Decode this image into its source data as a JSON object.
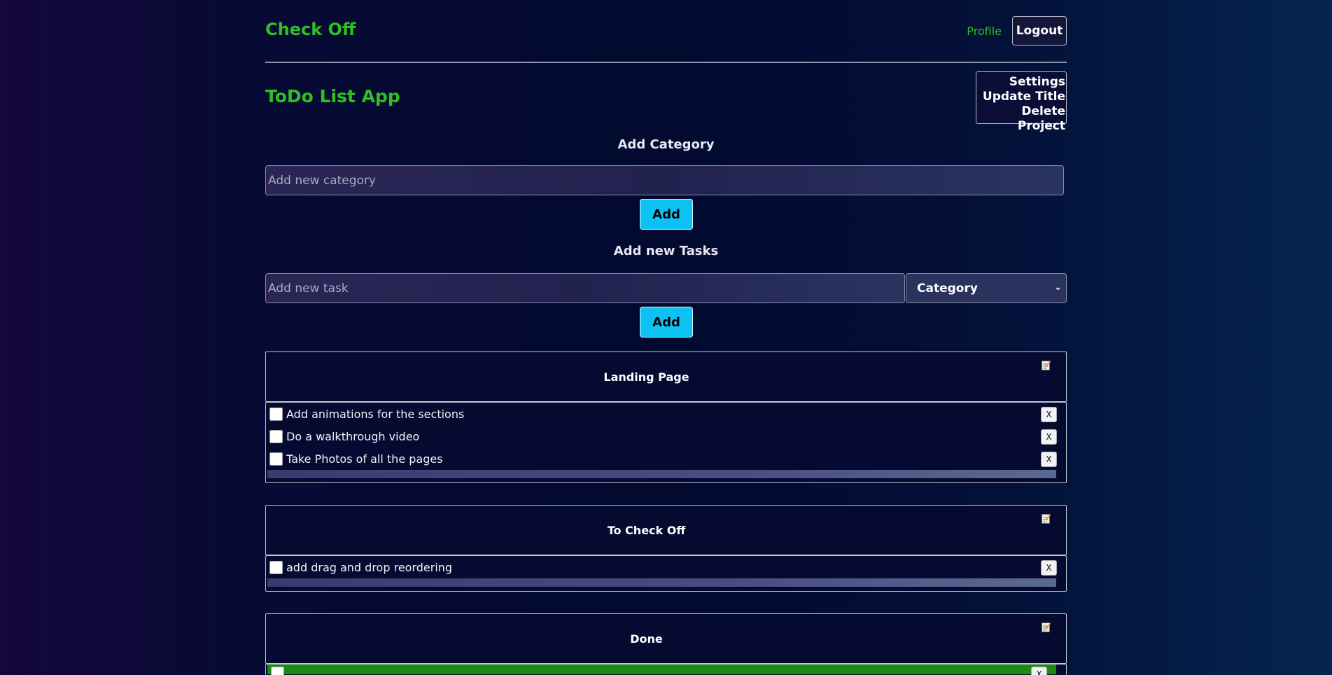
{
  "header": {
    "brand": "Check Off",
    "profile_label": "Profile",
    "logout_label": "Logout"
  },
  "project": {
    "title": "ToDo List App"
  },
  "settings_menu": {
    "settings_label": "Settings",
    "update_title_label": "Update Title",
    "delete_project_label": "Delete Project"
  },
  "add_category": {
    "heading": "Add Category",
    "placeholder": "Add new category",
    "button_label": "Add"
  },
  "add_task": {
    "heading": "Add new Tasks",
    "placeholder": "Add new task",
    "category_select_value": "Category",
    "button_label": "Add"
  },
  "categories": [
    {
      "name": "Landing Page",
      "tasks": [
        {
          "label": "Add animations for the sections",
          "delete_label": "X"
        },
        {
          "label": "Do a walkthrough video",
          "delete_label": "X"
        },
        {
          "label": "Take Photos of all the pages",
          "delete_label": "X"
        }
      ]
    },
    {
      "name": "To Check Off",
      "tasks": [
        {
          "label": "add drag and drop reordering",
          "delete_label": "X"
        }
      ]
    },
    {
      "name": "Done",
      "tasks": [
        {
          "label": "",
          "delete_label": "X"
        }
      ]
    }
  ],
  "colors": {
    "brand_green": "#2ec11f",
    "add_button": "#0ec1f3",
    "done_row": "#1f8a12"
  }
}
